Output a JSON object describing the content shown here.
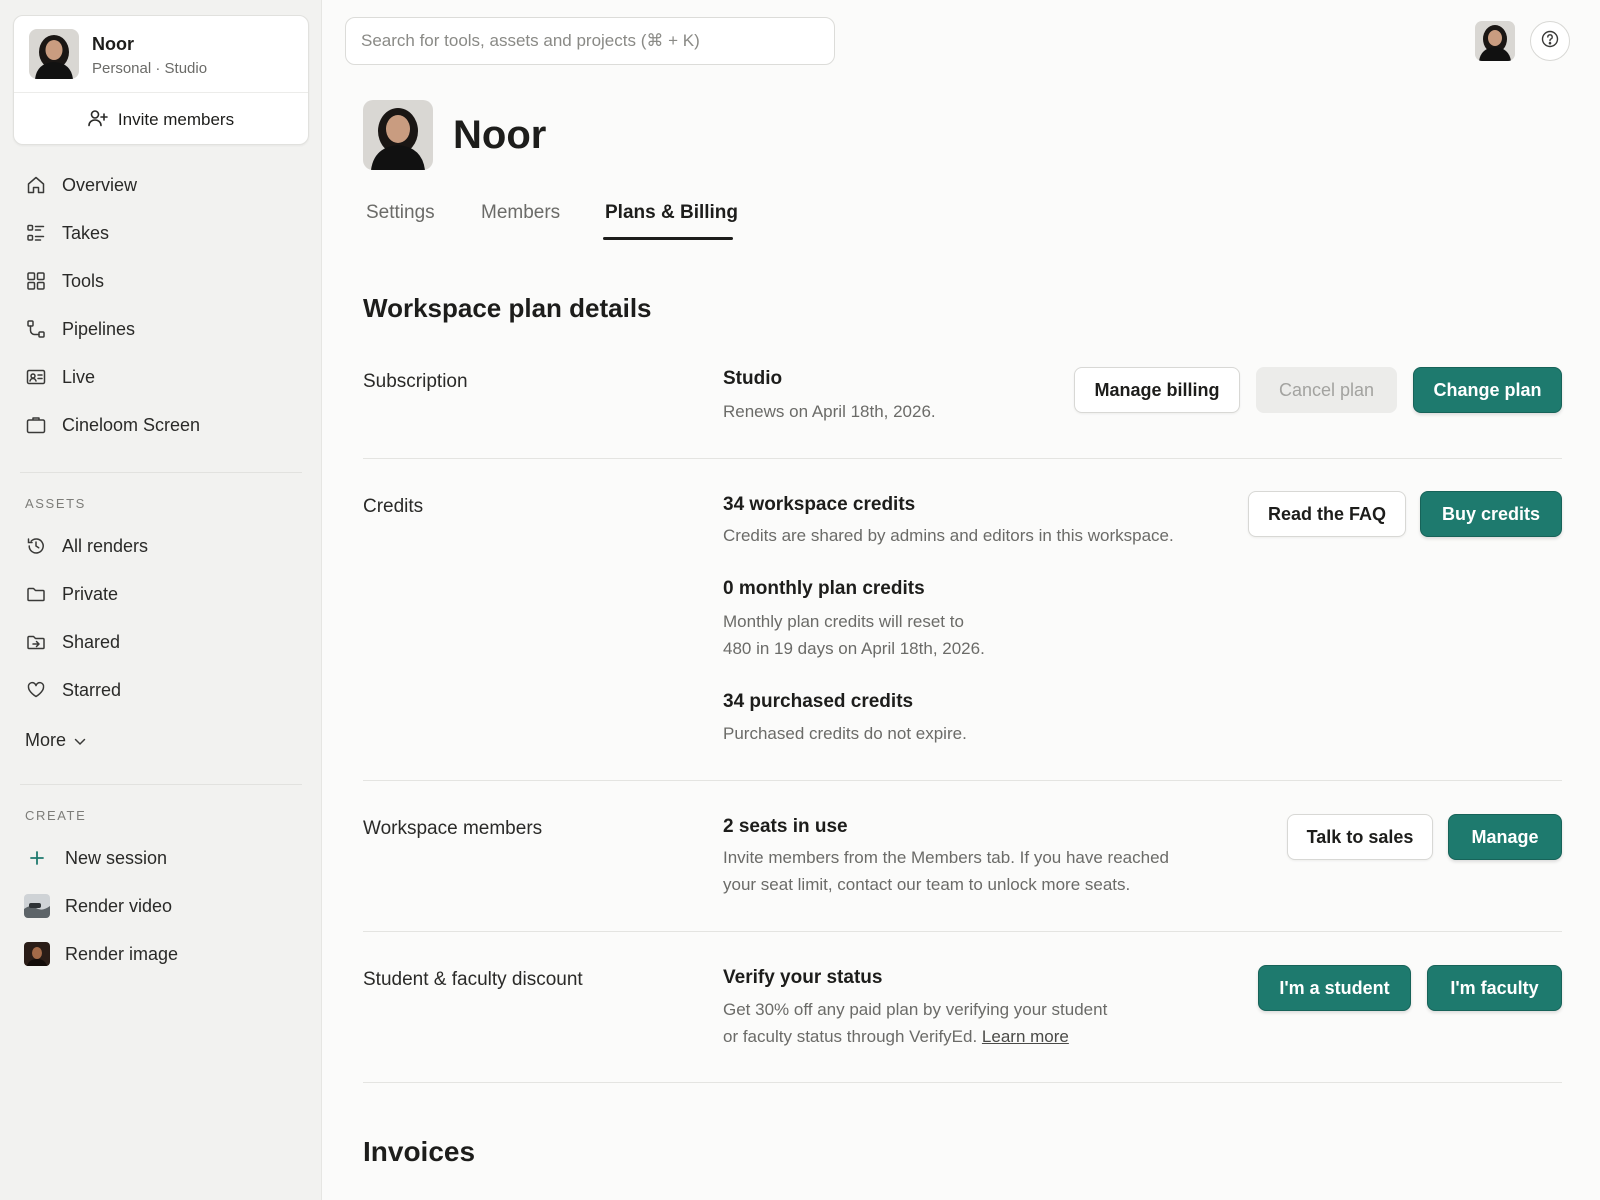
{
  "sidebar": {
    "workspace": {
      "name": "Noor",
      "subtitle": "Personal · Studio",
      "invite_label": "Invite members"
    },
    "nav": [
      {
        "label": "Overview",
        "icon": "home-icon"
      },
      {
        "label": "Takes",
        "icon": "list-icon"
      },
      {
        "label": "Tools",
        "icon": "grid-icon"
      },
      {
        "label": "Pipelines",
        "icon": "flow-icon"
      },
      {
        "label": "Live",
        "icon": "id-card-icon"
      },
      {
        "label": "Cineloom Screen",
        "icon": "tv-icon"
      }
    ],
    "assets_label": "ASSETS",
    "assets": [
      {
        "label": "All renders",
        "icon": "history-icon"
      },
      {
        "label": "Private",
        "icon": "folder-icon"
      },
      {
        "label": "Shared",
        "icon": "shared-folder-icon"
      },
      {
        "label": "Starred",
        "icon": "heart-icon"
      }
    ],
    "more_label": "More",
    "create_label": "CREATE",
    "create": [
      {
        "label": "New session",
        "icon": "plus-icon"
      },
      {
        "label": "Render video",
        "icon": "video-thumbnail"
      },
      {
        "label": "Render image",
        "icon": "image-thumbnail"
      }
    ]
  },
  "topbar": {
    "search_placeholder": "Search for tools, assets and projects (⌘ + K)",
    "help_icon": "help-icon"
  },
  "header": {
    "name": "Noor",
    "tabs": [
      {
        "label": "Settings",
        "active": false
      },
      {
        "label": "Members",
        "active": false
      },
      {
        "label": "Plans & Billing",
        "active": true
      }
    ]
  },
  "plan": {
    "title": "Workspace plan details",
    "subscription": {
      "label": "Subscription",
      "plan_name": "Studio",
      "renews": "Renews on April 18th, 2026.",
      "manage_billing": "Manage billing",
      "cancel_plan": "Cancel plan",
      "change_plan": "Change plan"
    },
    "credits": {
      "label": "Credits",
      "workspace_title": "34 workspace credits",
      "workspace_desc": "Credits are shared by admins and editors in this workspace.",
      "monthly_title": "0 monthly plan credits",
      "monthly_desc_1": "Monthly plan credits will reset to",
      "monthly_desc_2": "480 in 19 days on April 18th, 2026.",
      "purchased_title": "34 purchased credits",
      "purchased_desc": "Purchased credits do not expire.",
      "read_faq": "Read the FAQ",
      "buy_credits": "Buy credits"
    },
    "members": {
      "label": "Workspace members",
      "seats_title": "2 seats in use",
      "desc_1": "Invite members from the Members tab. If you have reached",
      "desc_2": "your seat limit, contact our team to unlock more seats.",
      "talk_to_sales": "Talk to sales",
      "manage": "Manage"
    },
    "discount": {
      "label": "Student & faculty discount",
      "title": "Verify your status",
      "desc_1": "Get 30% off any paid plan by verifying your student",
      "desc_2": "or faculty status through VerifyEd.",
      "learn_more": "Learn more",
      "student": "I'm a student",
      "faculty": "I'm faculty"
    }
  },
  "invoices": {
    "title": "Invoices"
  },
  "colors": {
    "primary": "#1e7a6e",
    "sidebar_bg": "#f2f2f0",
    "page_bg": "#fbfbfa"
  }
}
